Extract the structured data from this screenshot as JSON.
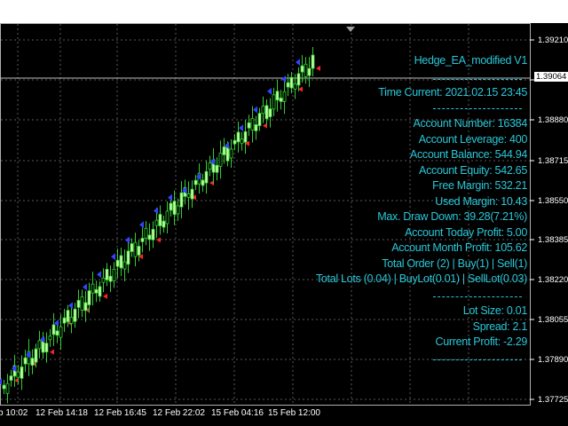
{
  "ea_title": "Hedge_EA_modified V1",
  "time_current": "Time Current: 2021.02.15 23:45",
  "account": {
    "number": "Account Number: 16384",
    "leverage": "Account Leverage: 400",
    "balance": "Account Balance: 544.94",
    "equity": "Account Equity: 542.65",
    "free_margin": "Free Margin: 532.21",
    "used_margin": "Used Margin: 10.43",
    "max_drawdown": "Max. Draw Down: 39.28(7.21%)",
    "today_profit": "Account Today Profit: 5.00",
    "month_profit": "Account Month Profit: 105.62",
    "total_order": "Total Order (2) | Buy(1) | Sell(1)",
    "total_lots": "Total Lots (0.04) | BuyLot(0.01) | SellLot(0.03)"
  },
  "trade": {
    "lot_size": "Lot Size: 0.01",
    "spread": "Spread: 2.1",
    "current_profit": "Current Profit: -2.29"
  },
  "price_axis": {
    "labels": [
      "1.39210",
      "1.39064",
      "1.38880",
      "1.38715",
      "1.38550",
      "1.38385",
      "1.38220",
      "1.38055",
      "1.37890",
      "1.37725"
    ],
    "current_price": "1.39064"
  },
  "time_axis": {
    "labels": [
      "b 10:02",
      "12 Feb 14:18",
      "12 Feb 16:45",
      "12 Feb 22:02",
      "15 Feb 04:16",
      "15 Feb 12:00"
    ]
  },
  "colors": {
    "background": "#000000",
    "text_accent": "#29c8d8",
    "bull_candle": "#ccffaa",
    "bear_candle": "#000000",
    "wick": "#33cc33",
    "grid": "#5a5a5a",
    "buy_arrow": "#3344ff",
    "sell_arrow": "#ff2222"
  }
}
